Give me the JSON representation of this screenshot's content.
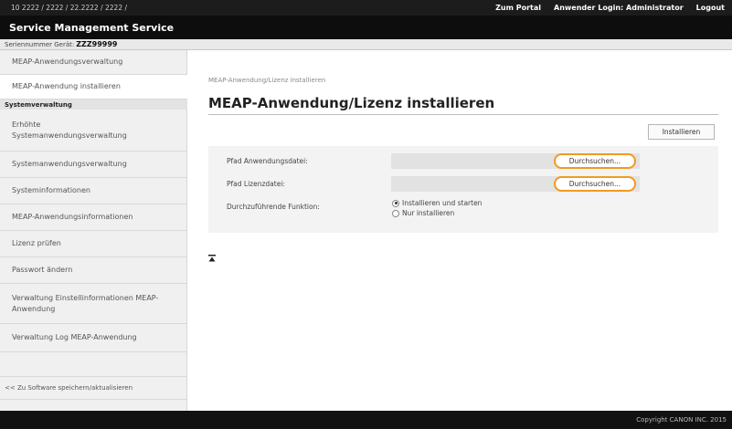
{
  "topbar": {
    "url": "10 2222 / 2222 / 22.2222 / 2222 /",
    "portal": "Zum Portal",
    "login": "Anwender Login: Administrator",
    "logout": "Logout"
  },
  "app_title": "Service Management Service",
  "serial": {
    "label": "Seriennummer Gerät:",
    "value": "ZZZ99999"
  },
  "sidebar": {
    "items_top": [
      {
        "label": "MEAP-Anwendungsverwaltung"
      },
      {
        "label": "MEAP-Anwendung installieren"
      }
    ],
    "section_header": "Systemverwaltung",
    "items": [
      {
        "label": "Erhöhte Systemanwendungsverwaltung"
      },
      {
        "label": "Systemanwendungsverwaltung"
      },
      {
        "label": "Systeminformationen"
      },
      {
        "label": "MEAP-Anwendungsinformationen"
      },
      {
        "label": "Lizenz prüfen"
      },
      {
        "label": "Passwort ändern"
      },
      {
        "label": "Verwaltung Einstellinformationen MEAP-Anwendung"
      },
      {
        "label": "Verwaltung Log MEAP-Anwendung"
      }
    ],
    "bottom_link": "<< Zu Software speichern/aktualisieren"
  },
  "main": {
    "breadcrumb": "MEAP-Anwendung/Lizenz installieren",
    "title": "MEAP-Anwendung/Lizenz installieren",
    "install_button": "Installieren",
    "form": {
      "app_file_label": "Pfad Anwendungsdatei:",
      "license_file_label": "Pfad Lizenzdatei:",
      "browse_label": "Durchsuchen...",
      "function_label": "Durchzuführende Funktion:",
      "options": [
        "Installieren und starten",
        "Nur installieren"
      ],
      "selected_option": "Installieren und starten"
    }
  },
  "footer": "Copyright CANON INC. 2015",
  "colors": {
    "accent": "#f29a1f",
    "header": "#0d0d0d",
    "topbar": "#1c1c1c"
  },
  "icons": {
    "back_to_top": "back-to-top-icon"
  }
}
